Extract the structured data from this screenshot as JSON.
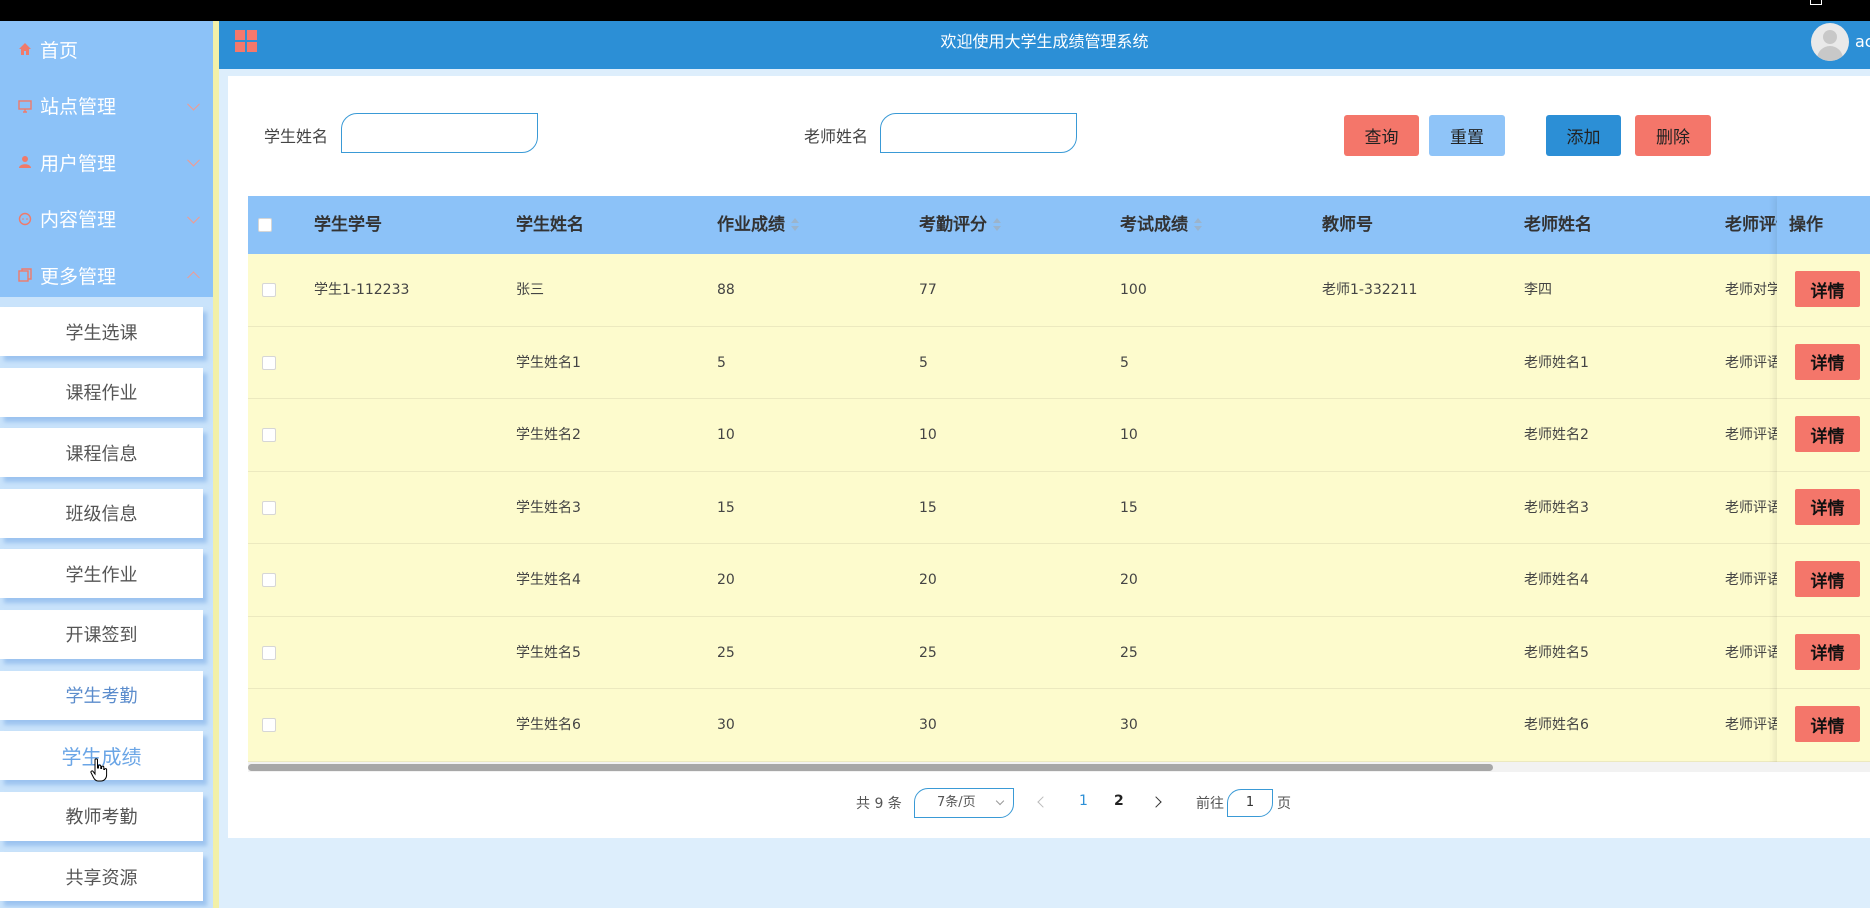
{
  "header": {
    "title": "欢迎使用大学生成绩管理系统",
    "user": "ac"
  },
  "sidebar": {
    "items": [
      {
        "label": "首页",
        "icon": "home-icon"
      },
      {
        "label": "站点管理",
        "icon": "monitor-icon"
      },
      {
        "label": "用户管理",
        "icon": "user-icon"
      },
      {
        "label": "内容管理",
        "icon": "message-icon"
      },
      {
        "label": "更多管理",
        "icon": "copy-icon"
      }
    ],
    "submenu": [
      "学生选课",
      "课程作业",
      "课程信息",
      "班级信息",
      "学生作业",
      "开课签到",
      "学生考勤",
      "学生成绩",
      "教师考勤",
      "共享资源"
    ],
    "active": "学生成绩"
  },
  "search": {
    "student_label": "学生姓名",
    "student_value": "",
    "teacher_label": "老师姓名",
    "teacher_value": ""
  },
  "toolbar": {
    "query": "查询",
    "reset": "重置",
    "add": "添加",
    "delete": "删除"
  },
  "table": {
    "columns": [
      "学生学号",
      "学生姓名",
      "作业成绩",
      "考勤评分",
      "考试成绩",
      "教师号",
      "老师姓名",
      "老师评语"
    ],
    "action_header": "操作",
    "action_label": "详情",
    "rows": [
      {
        "student_no": "学生1-112233",
        "student_name": "张三",
        "homework": "88",
        "attendance": "77",
        "exam": "100",
        "teacher_no": "老师1-332211",
        "teacher_name": "李四",
        "comment": "老师对学"
      },
      {
        "student_no": "",
        "student_name": "学生姓名1",
        "homework": "5",
        "attendance": "5",
        "exam": "5",
        "teacher_no": "",
        "teacher_name": "老师姓名1",
        "comment": "老师评语"
      },
      {
        "student_no": "",
        "student_name": "学生姓名2",
        "homework": "10",
        "attendance": "10",
        "exam": "10",
        "teacher_no": "",
        "teacher_name": "老师姓名2",
        "comment": "老师评语"
      },
      {
        "student_no": "",
        "student_name": "学生姓名3",
        "homework": "15",
        "attendance": "15",
        "exam": "15",
        "teacher_no": "",
        "teacher_name": "老师姓名3",
        "comment": "老师评语"
      },
      {
        "student_no": "",
        "student_name": "学生姓名4",
        "homework": "20",
        "attendance": "20",
        "exam": "20",
        "teacher_no": "",
        "teacher_name": "老师姓名4",
        "comment": "老师评语"
      },
      {
        "student_no": "",
        "student_name": "学生姓名5",
        "homework": "25",
        "attendance": "25",
        "exam": "25",
        "teacher_no": "",
        "teacher_name": "老师姓名5",
        "comment": "老师评语"
      },
      {
        "student_no": "",
        "student_name": "学生姓名6",
        "homework": "30",
        "attendance": "30",
        "exam": "30",
        "teacher_no": "",
        "teacher_name": "老师姓名6",
        "comment": "老师评语"
      }
    ]
  },
  "pagination": {
    "total": "共 9 条",
    "page_size": "7条/页",
    "pages": [
      "1",
      "2"
    ],
    "current": "1",
    "goto_label": "前往",
    "goto_value": "1",
    "page_suffix": "页"
  },
  "colors": {
    "header": "#2c8fd6",
    "sidebar_top": "#8cc2f8",
    "accent_red": "#f4766a",
    "row_bg": "#fdfbcd"
  }
}
